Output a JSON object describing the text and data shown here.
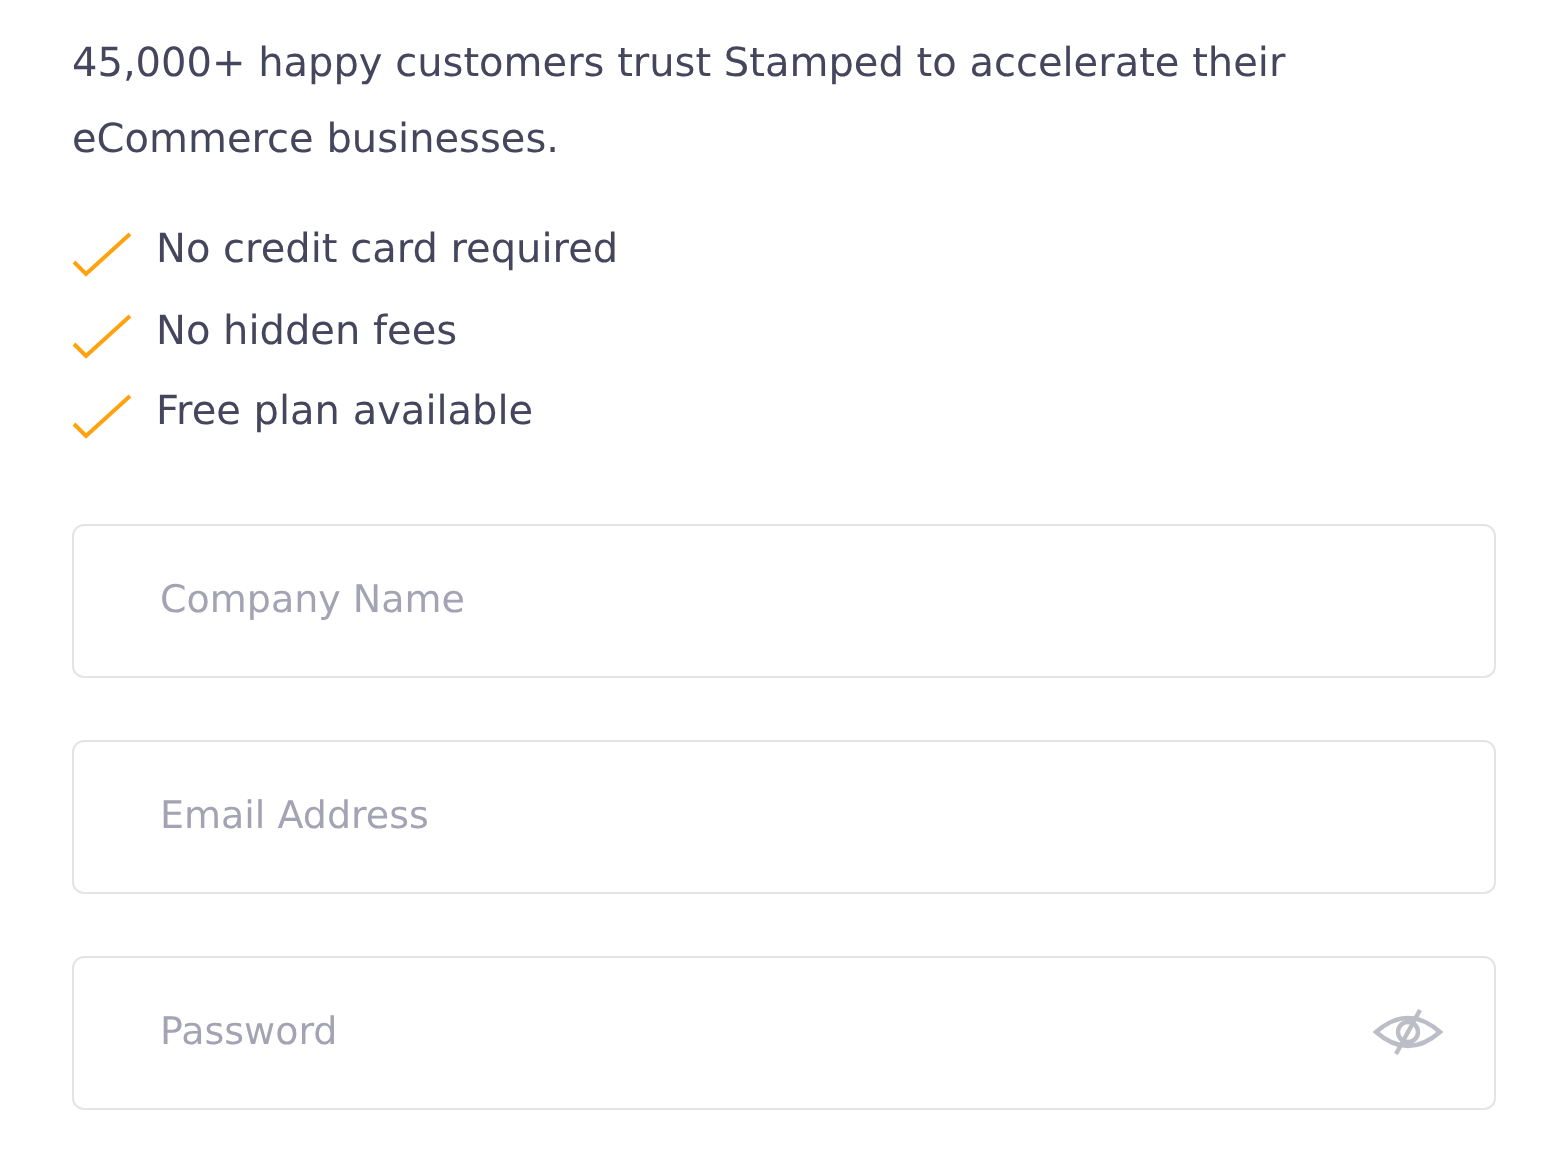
{
  "intro": "45,000+ happy customers trust Stamped to accelerate their eCommerce businesses.",
  "benefits": [
    "No credit card required",
    "No hidden fees",
    "Free plan available"
  ],
  "fields": [
    {
      "kind": "text",
      "placeholder": "Company Name"
    },
    {
      "kind": "email",
      "placeholder": "Email Address"
    },
    {
      "kind": "password",
      "placeholder": "Password"
    }
  ]
}
